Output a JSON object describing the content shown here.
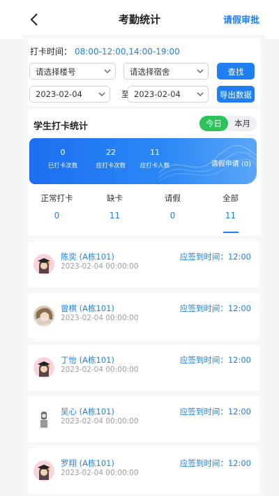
{
  "nav": {
    "title": "考勤统计",
    "right_action": "请假审批"
  },
  "filter": {
    "time_label": "打卡时间：",
    "time_value": "08:00-12:00,14:00-19:00",
    "building_select": "请选择楼号",
    "dorm_select": "请选择宿舍",
    "search_button": "查找",
    "start_date": "2023-02-04",
    "date_separator": "至",
    "end_date": "2023-02-04",
    "export_button": "导出数据"
  },
  "stats": {
    "title": "学生打卡统计",
    "toggle": {
      "today": "今日",
      "month": "本月"
    },
    "summary": [
      {
        "value": "0",
        "label": "已打卡次数"
      },
      {
        "value": "22",
        "label": "应打卡次数"
      },
      {
        "value": "11",
        "label": "应打卡人数"
      }
    ],
    "leave_request": "请假申请 (0)",
    "tabs": [
      {
        "label": "正常打卡",
        "count": "0"
      },
      {
        "label": "缺卡",
        "count": "11"
      },
      {
        "label": "请假",
        "count": "0"
      },
      {
        "label": "全部",
        "count": "11"
      }
    ]
  },
  "records": [
    {
      "name": "陈奕 (A栋101)",
      "datetime": "2023-02-04 00:00:00",
      "checkin": "应签到时间：12:00",
      "avatar": "graduate-avatar"
    },
    {
      "name": "曾棋 (A栋101)",
      "datetime": "2023-02-04 00:00:00",
      "checkin": "应签到时间：12:00",
      "avatar": "photo-avatar"
    },
    {
      "name": "丁怡 (A栋101)",
      "datetime": "2023-02-04 00:00:00",
      "checkin": "应签到时间：12:00",
      "avatar": "graduate-avatar"
    },
    {
      "name": "吴心 (A栋101)",
      "datetime": "2023-02-04 00:00:00",
      "checkin": "应签到时间：12:00",
      "avatar": "sketch-avatar"
    },
    {
      "name": "罗翔 (A栋101)",
      "datetime": "2023-02-04 00:00:00",
      "checkin": "应签到时间：12:00",
      "avatar": "graduate-avatar"
    }
  ],
  "colors": {
    "primary": "#1f7ef0",
    "accent_green": "#2ec25a",
    "muted": "#9a9ea6"
  }
}
